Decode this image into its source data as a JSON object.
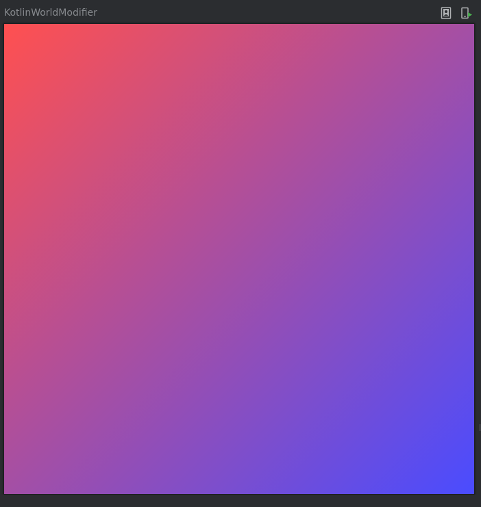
{
  "window": {
    "title": "KotlinWorldModifier"
  },
  "toolbar": {
    "items": [
      {
        "icon": "device-portrait-icon"
      },
      {
        "icon": "deploy-device-icon"
      }
    ],
    "accent_color": "#4caf50"
  },
  "preview": {
    "gradient_start": "#ff5050",
    "gradient_mid": "#a44fa5",
    "gradient_end": "#4a4cff"
  }
}
